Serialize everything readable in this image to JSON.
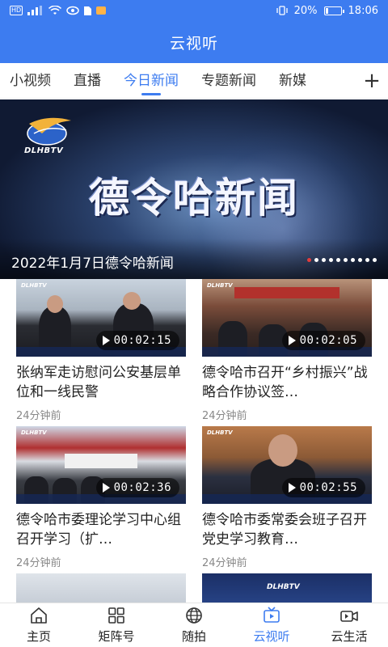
{
  "status_bar": {
    "left_icons": [
      "hd-icon",
      "signal-icon",
      "wifi-icon",
      "eye-icon",
      "sim-icon",
      "notification-icon"
    ],
    "vibrate_icon": "vibrate-icon",
    "battery_percent": "20%",
    "battery_level": 0.2,
    "time": "18:06"
  },
  "header": {
    "title": "云视听"
  },
  "tabs": {
    "items": [
      {
        "label": "小视频"
      },
      {
        "label": "直播"
      },
      {
        "label": "今日新闻"
      },
      {
        "label": "专题新闻"
      },
      {
        "label": "新媒"
      }
    ],
    "active_index": 2,
    "add_label": "+"
  },
  "banner": {
    "logo_text": "DLHBTV",
    "title": "德令哈新闻",
    "caption": "2022年1月7日德令哈新闻",
    "dot_count": 10,
    "active_dot": 0
  },
  "videos": [
    {
      "title": "张纳军走访慰问公安基层单位和一线民警",
      "duration": "00:02:15",
      "time": "24分钟前"
    },
    {
      "title": "德令哈市召开“乡村振兴”战略合作协议签…",
      "duration": "00:02:05",
      "time": "24分钟前"
    },
    {
      "title": "德令哈市委理论学习中心组召开学习（扩…",
      "duration": "00:02:36",
      "time": "24分钟前"
    },
    {
      "title": "德令哈市委常委会班子召开党史学习教育…",
      "duration": "00:02:55",
      "time": "24分钟前"
    }
  ],
  "thumb_logo": "DLHBTV",
  "bottom_nav": {
    "items": [
      {
        "label": "主页",
        "icon": "home-icon"
      },
      {
        "label": "矩阵号",
        "icon": "grid-icon"
      },
      {
        "label": "随拍",
        "icon": "globe-icon"
      },
      {
        "label": "云视听",
        "icon": "tv-icon"
      },
      {
        "label": "云生活",
        "icon": "video-camera-icon"
      }
    ],
    "active_index": 3
  },
  "colors": {
    "brand": "#3d7cf0",
    "active_dot": "#e33c3c"
  }
}
